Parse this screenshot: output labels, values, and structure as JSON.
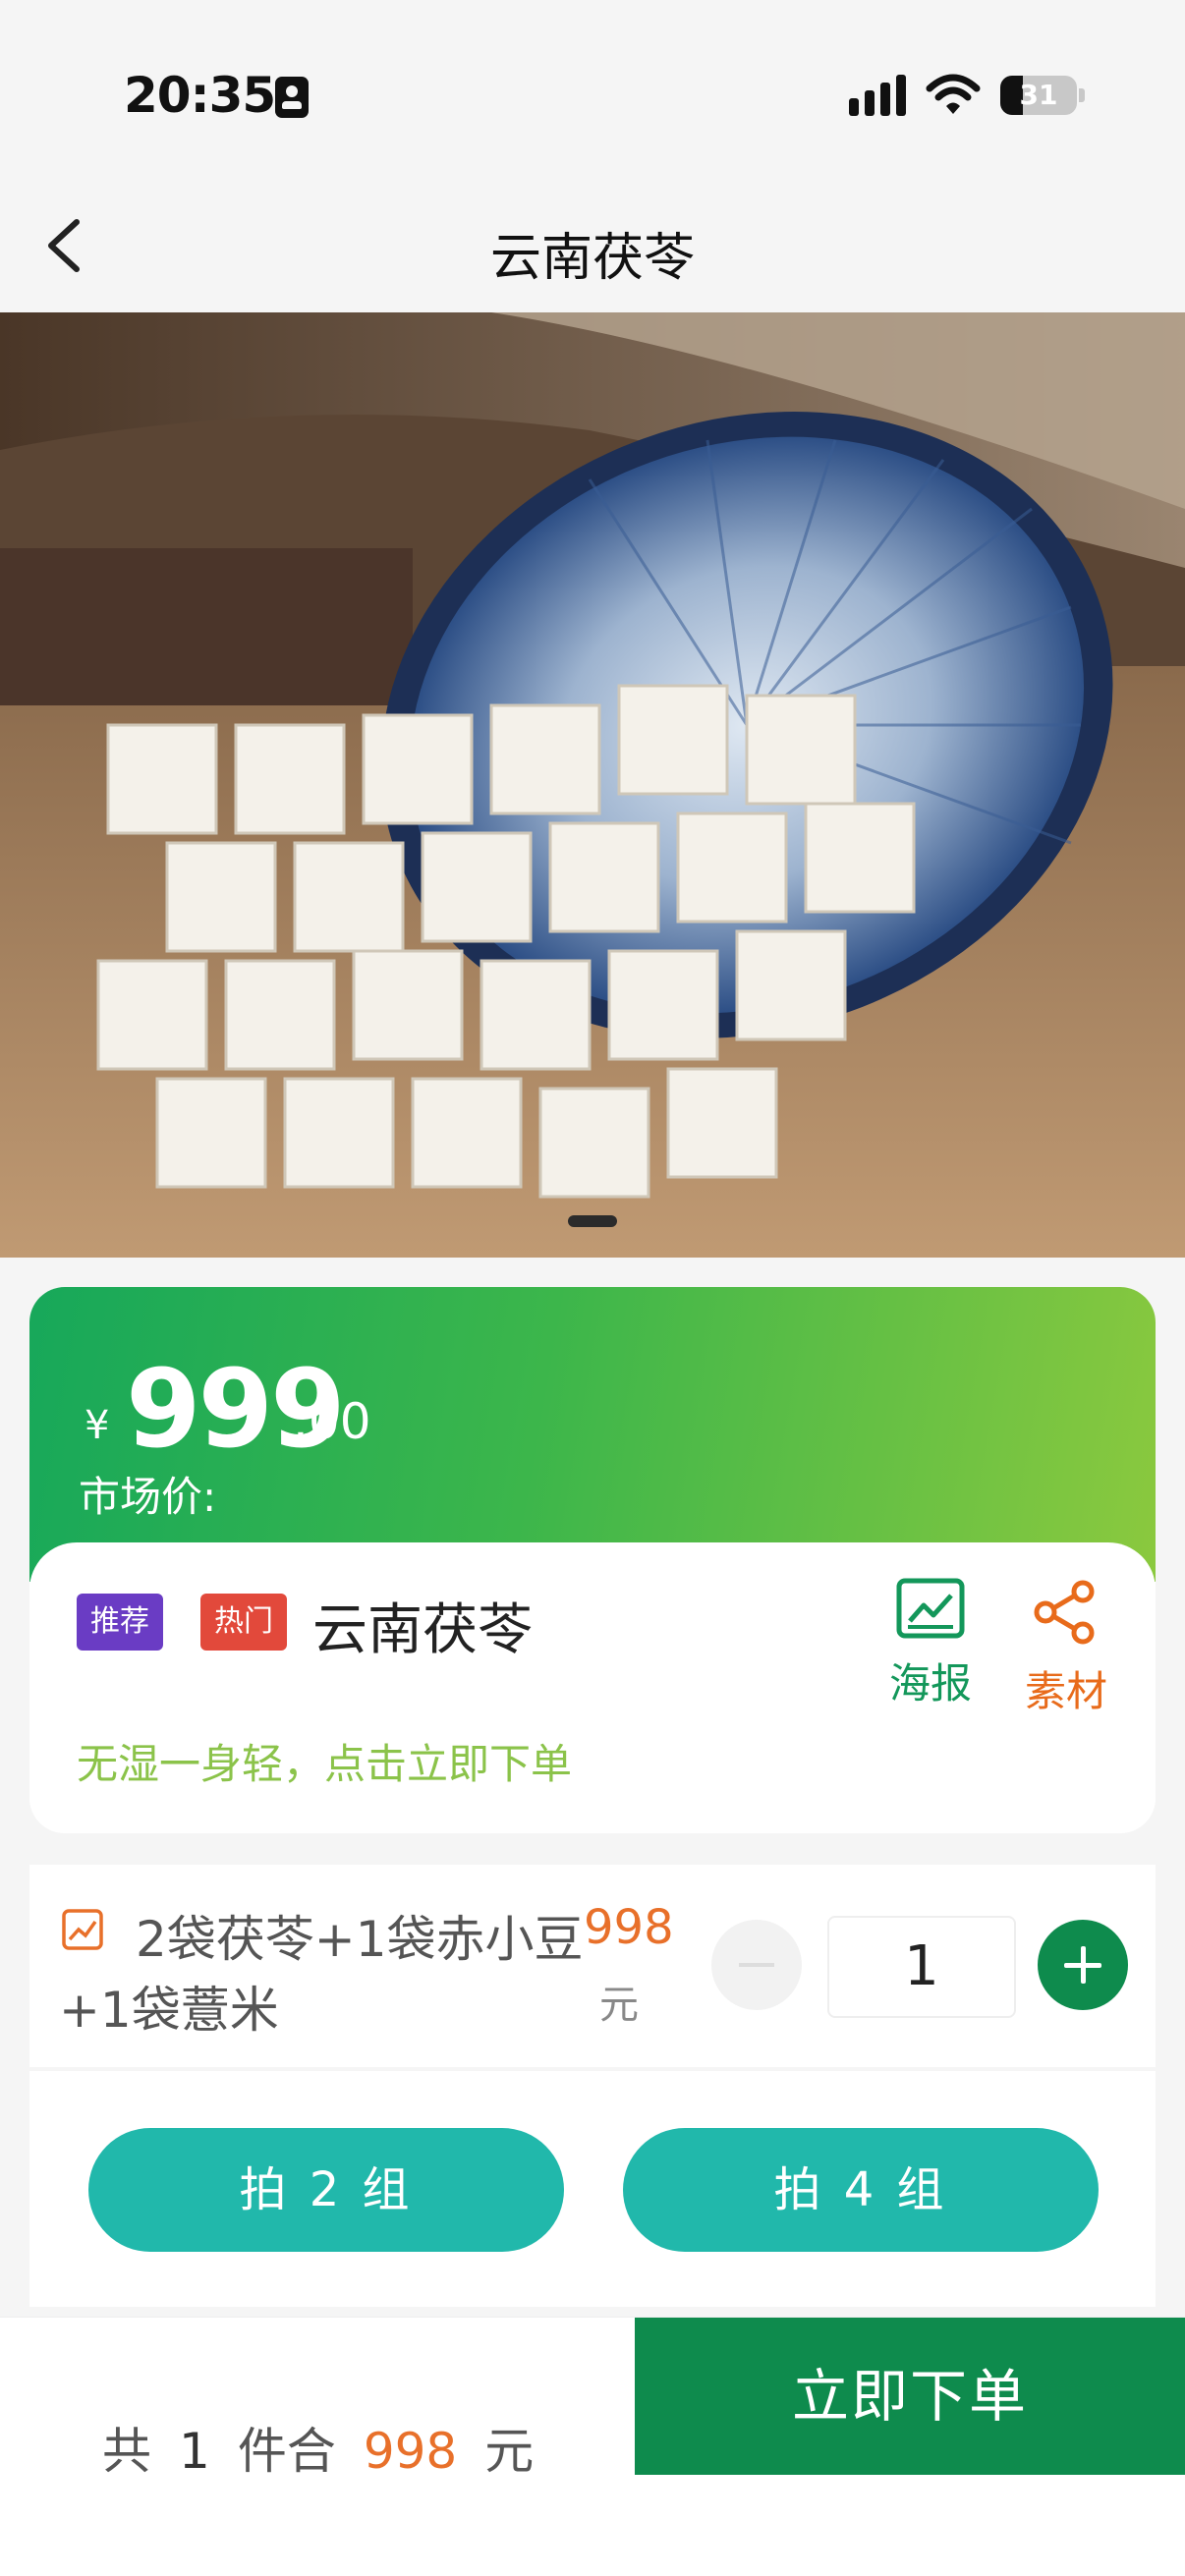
{
  "status_bar": {
    "time": "20:35",
    "battery": "31"
  },
  "nav": {
    "title": "云南茯苓"
  },
  "product": {
    "price_symbol": "¥",
    "price_integer": "999",
    "price_decimal": ".00",
    "market_price_label": "市场价:",
    "tags": [
      "推荐",
      "热门"
    ],
    "name": "云南茯苓",
    "subtitle": "无湿一身轻，点击立即下单",
    "actions": {
      "poster": "海报",
      "material": "素材"
    }
  },
  "option": {
    "name_line1": "2袋茯苓+1袋赤小豆",
    "name_line2": "+1袋薏米",
    "price": "998",
    "unit": "元",
    "quantity": "1"
  },
  "bulk": {
    "buy_2": "拍 2 组",
    "buy_4": "拍 4 组"
  },
  "bottom": {
    "prefix": "共",
    "count": "1",
    "middle": "件合",
    "total": "998",
    "unit": "元",
    "order_button": "立即下单"
  },
  "colors": {
    "primary_green": "#0e8b4d",
    "teal_button": "#21b8ab",
    "orange_price": "#e8702a",
    "subtitle_green": "#8bc34a",
    "tag_recommend": "#6a3cc4",
    "tag_hot": "#e2493b"
  }
}
